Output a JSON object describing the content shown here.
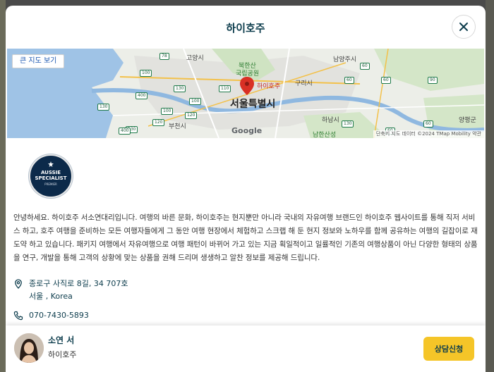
{
  "modal": {
    "title": "하이호주"
  },
  "map": {
    "view_larger_label": "큰 지도 보기",
    "attribution": "단축키   지도 데이터 ©2024 TMap Mobility   약관",
    "pin_label": "하이호주",
    "google_label": "Google",
    "places": {
      "seoul": "서울특별시",
      "goyang": "고양시",
      "bukhansan": "북한산",
      "national_park": "국립공원",
      "namyangju": "남양주시",
      "guri": "구리시",
      "hanam": "하남시",
      "bucheon": "부천시",
      "yangpyeong": "양평군",
      "namhansanseong": "남한산성"
    },
    "highway_numbers": [
      "78",
      "100",
      "130",
      "400",
      "130",
      "100",
      "110",
      "120",
      "120",
      "130",
      "400",
      "130",
      "60",
      "60",
      "60",
      "60",
      "60",
      "100",
      "90"
    ]
  },
  "profile": {
    "badge": {
      "line1": "AUSSIE",
      "line2": "SPECIALIST",
      "line3": "PREMIER"
    },
    "description": "안녕하세요. 하이호주 서소연대리입니다. 여행의 바른 문화, 하이호주는 현지뿐만 아니라 국내의 자유여행 브랜드인 하이호주 웹사이트를 통해 직저 서비스 하고, 호주 여행을 준비하는 모든 여행자들에게 그 동안 여행 현장에서 체험하고 스크랩 해 둔 현지 정보와 노하우를 함께 공유하는 여행의 길잡이로 재도약 하고 있습니다. 패키지 여행에서 자유여행으로 여행 패턴이 바뀌어 가고 있는 지금 획일적이고 일률적인 기존의 여행상품이 아닌 다양한 형태의 상품을 연구, 개발을 통해 고객의 상황에 맞는 상품을 권해 드리며 생생하고 알찬 정보를 제공해 드립니다.",
    "address_line1": "종로구 사직로 8길, 34 707호",
    "address_line2": "서울 , Korea",
    "phone": "070-7430-5893"
  },
  "footer": {
    "agent_name": "소연 서",
    "agent_company": "하이호주",
    "consult_label": "상담신청"
  },
  "colors": {
    "brand_dark": "#0c3c4c",
    "accent_yellow": "#f5c528",
    "pin_red": "#d93025"
  }
}
